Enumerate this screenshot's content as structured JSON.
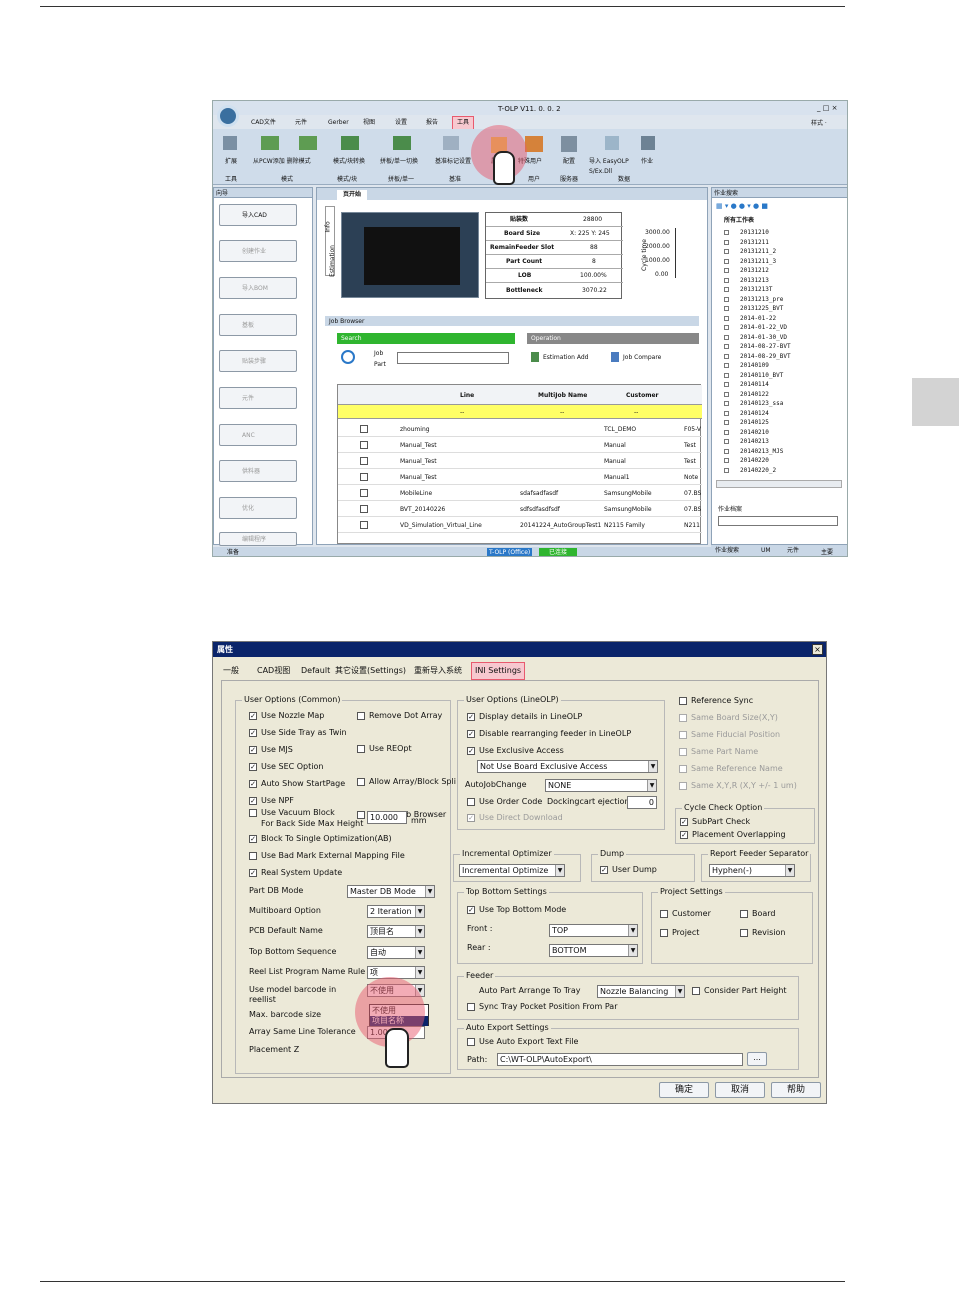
{
  "s1": {
    "title": "T-OLP V11. 0. 0. 2",
    "win_btns": "_ □ ×",
    "style_label": "样式 ·",
    "menus": [
      "CAD文件",
      "元件",
      "Gerber",
      "视图",
      "设置",
      "报告",
      "工具"
    ],
    "ribbon": [
      "扩展",
      "从PCW添加 删除模式",
      "模式/块转换",
      "拼板/单一切换",
      "基准标记设置",
      "属性",
      "特殊用户",
      "配置",
      "导入 EasyOLP S/Ex.Dll",
      "作业"
    ],
    "groups": [
      "工具",
      "模式",
      "模式/块",
      "拼板/单一",
      "基准",
      "用户",
      "服务器",
      "数据"
    ],
    "left_title": "向导",
    "left_btns": [
      "导入CAD",
      "创建作业",
      "导入BOM",
      "基板",
      "贴装步骤",
      "元件",
      "ANC",
      "供料器",
      "优化",
      "编辑程序"
    ],
    "doc_tab": "页开始",
    "side_tabs": [
      "Info",
      "Estimation"
    ],
    "stats": [
      [
        "贴装数",
        "28800"
      ],
      [
        "Board Size",
        "X: 225  Y: 245"
      ],
      [
        "RemainFeeder Slot",
        "88"
      ],
      [
        "Part Count",
        "8"
      ],
      [
        "LOB",
        "100.00%"
      ],
      [
        "Bottleneck",
        "3070.22"
      ]
    ],
    "cycle_label": "Cycle time",
    "cycle_ticks": [
      "3000.00",
      "2000.00",
      "1000.00",
      "0.00"
    ],
    "job_browser": "Job Browser",
    "search": "Search",
    "operation": "Operation",
    "radio_job": "Job",
    "radio_part": "Part",
    "op_estimation": "Estimation Add",
    "op_compare": "Job Compare",
    "cols": [
      "Line",
      "MultiJob Name",
      "Customer"
    ],
    "filter": "--",
    "rows": [
      {
        "line": "zhouming",
        "multi": "",
        "cust": "TCL_DEMO",
        "ext": "F05-V"
      },
      {
        "line": "Manual_Test",
        "multi": "",
        "cust": "Manual",
        "ext": "Test"
      },
      {
        "line": "Manual_Test",
        "multi": "",
        "cust": "Manual",
        "ext": "Test"
      },
      {
        "line": "Manual_Test",
        "multi": "",
        "cust": "Manual1",
        "ext": "Note"
      },
      {
        "line": "MobileLine",
        "multi": "sdafsadfasdf",
        "cust": "SamsungMobile",
        "ext": "07.BS"
      },
      {
        "line": "BVT_20140226",
        "multi": "sdfsdfasdfsdf",
        "cust": "SamsungMobile",
        "ext": "07.BS"
      },
      {
        "line": "VD_Simulation_Virtual_Line",
        "multi": "20141224_AutoGroupTest1",
        "cust": "N2115 Family",
        "ext": "N211"
      }
    ],
    "right_title": "作业搜索",
    "tree_root": "所有工作表",
    "tree": [
      "20131210",
      "20131211",
      "20131211_2",
      "20131211_3",
      "20131212",
      "20131213",
      "20131213T",
      "20131213_pre",
      "20131225_BVT",
      "2014-01-22",
      "2014-01-22_VD",
      "2014-01-30_VD",
      "2014-08-27-BVT",
      "2014-08-29_BVT",
      "20140109",
      "20140110_BVT",
      "20140114",
      "20140122",
      "20140123_ssa",
      "20140124",
      "20140125",
      "20140210",
      "20140213",
      "20140213_MJS",
      "20140220",
      "20140220_2"
    ],
    "job_info": "作业档案",
    "bottom_tabs": [
      "作业搜索",
      "UM",
      "元件"
    ],
    "status": [
      "准备",
      "T-OLP (Office)",
      "已连接",
      "主要"
    ]
  },
  "s2": {
    "title": "属性",
    "close": "×",
    "tabs": [
      "一般",
      "CAD视图",
      "Default",
      "其它设置(Settings)",
      "重新导入系统",
      "INI Settings"
    ],
    "uoc": "User Options (Common)",
    "c1": [
      [
        "Use Nozzle Map",
        true
      ],
      [
        "Use Side Tray as Twin",
        true
      ],
      [
        "Use MJS",
        true
      ],
      [
        "Use SEC Option",
        true
      ],
      [
        "Auto Show StartPage",
        true
      ],
      [
        "Use NPF",
        true
      ]
    ],
    "c2": [
      [
        "Remove Dot Array",
        false
      ],
      [
        "Use REOpt",
        false
      ],
      [
        "Allow Array/Block Spli",
        false
      ],
      [
        "Simple Job Browser",
        false
      ]
    ],
    "vac1": "Use Vacuum Block",
    "vac2": "For Back Side Max Height",
    "vac_val": "10.000",
    "vac_unit": "mm",
    "c3": [
      [
        "Block To Single Optimization(AB)",
        true
      ],
      [
        "Use Bad Mark External Mapping File",
        false
      ],
      [
        "Real System Update",
        true
      ]
    ],
    "fields": [
      [
        "Part DB Mode",
        "Master DB Mode"
      ],
      [
        "Multiboard Option",
        "2 Iteration"
      ],
      [
        "PCB Default Name",
        "顶目名"
      ],
      [
        "Top Bottom Sequence",
        "自动"
      ],
      [
        "Reel List Program Name Rule",
        "项"
      ],
      [
        "Use model barcode in reellist",
        "不使用"
      ],
      [
        "Max. barcode size",
        ""
      ],
      [
        "Array Same Line Tolerance",
        "1.000"
      ],
      [
        "Placement Z",
        ""
      ]
    ],
    "popup": [
      "不使用",
      "项目名称"
    ],
    "uol": "User Options (LineOLP)",
    "l1": [
      [
        "Display details in LineOLP",
        true
      ],
      [
        "Disable rearranging feeder in LineOLP",
        true
      ],
      [
        "Use Exclusive Access",
        true
      ]
    ],
    "excl": "Not Use Board Exclusive Access",
    "autojob": "AutoJobChange",
    "autojob_val": "NONE",
    "ordercode": "Use Order Code",
    "docking": "Dockingcart ejection",
    "docking_val": "0",
    "direct": "Use Direct Download",
    "r1": [
      [
        "Reference Sync",
        false
      ],
      [
        "Same Board Size(X,Y)",
        false
      ],
      [
        "Same Fiducial Position",
        false
      ],
      [
        "Same Part Name",
        false
      ],
      [
        "Same Reference Name",
        false
      ],
      [
        "Same X,Y,R (X,Y +/- 1 um)",
        false
      ]
    ],
    "cco": "Cycle Check Option",
    "cc": [
      [
        "SubPart Check",
        true
      ],
      [
        "Placement Overlapping",
        true
      ]
    ],
    "inc": "Incremental Optimizer",
    "inc_val": "Incremental Optimize",
    "dump": "Dump",
    "user_dump": "User Dump",
    "rfs": "Report Feeder Separator",
    "rfs_val": "Hyphen(-)",
    "tbs": "Top Bottom Settings",
    "use_tb": "Use Top Bottom Mode",
    "front": "Front :",
    "front_val": "TOP",
    "rear": "Rear :",
    "rear_val": "BOTTOM",
    "ps": "Project Settings",
    "pset": [
      "Customer",
      "Board",
      "Project",
      "Revision"
    ],
    "feeder": "Feeder",
    "auto_part": "Auto Part Arrange To Tray",
    "auto_part_val": "Nozzle Balancing",
    "consider": "Consider Part Height",
    "sync": "Sync Tray Pocket Position From Par",
    "aes": "Auto Export Settings",
    "use_ae": "Use Auto Export Text File",
    "path": "Path:",
    "path_val": "C:\\WT-OLP\\AutoExport\\",
    "browse": "...",
    "buttons": [
      "确定",
      "取消",
      "帮助"
    ]
  },
  "colors": {
    "accent": "#e85a6e",
    "ribbon": "#cfdcea",
    "dialog": "#ece9d8",
    "select": "#0a246a"
  }
}
